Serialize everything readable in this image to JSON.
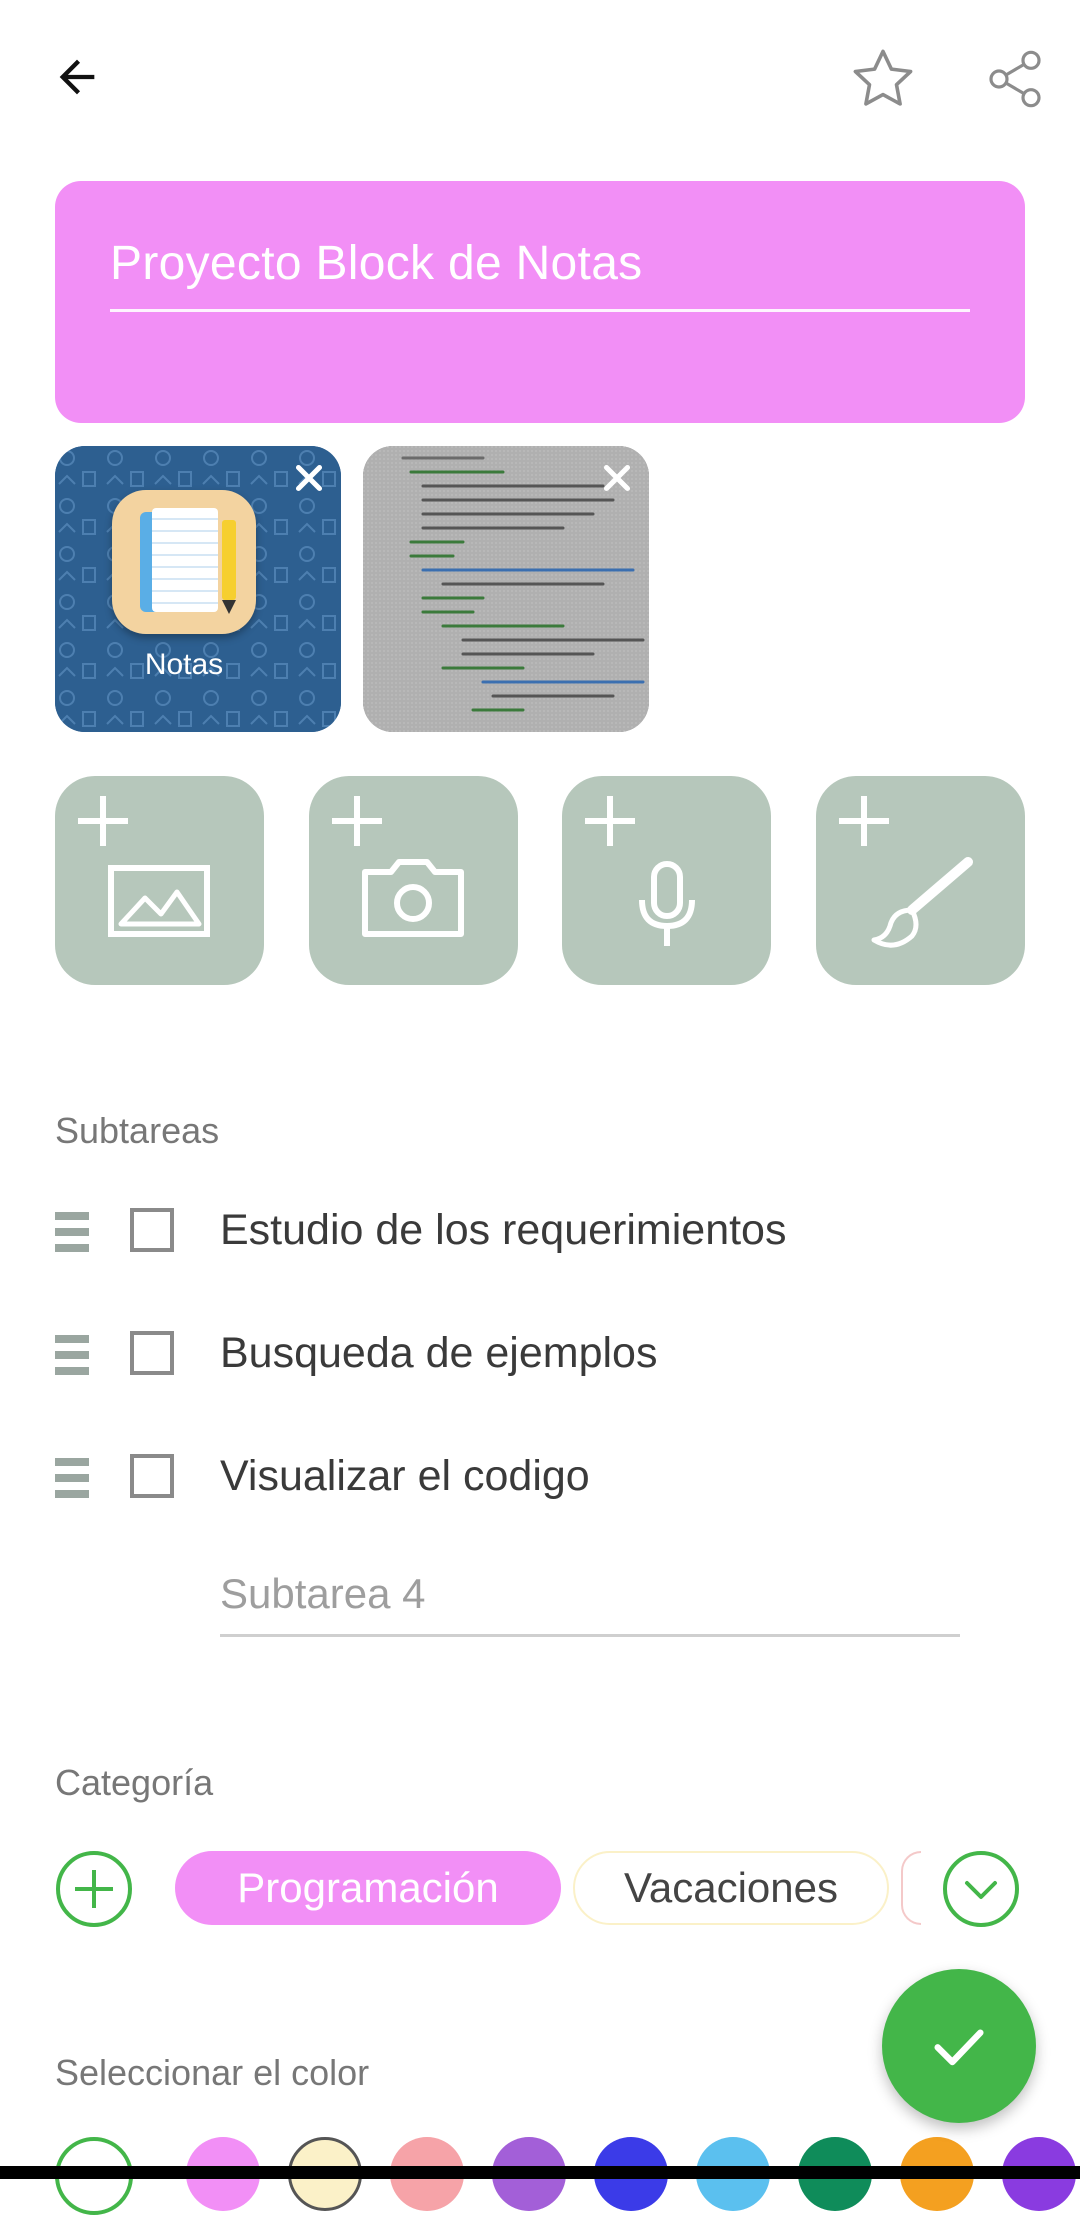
{
  "title": {
    "value": "Proyecto Block de Notas"
  },
  "thumbnails": [
    {
      "name": "Notas",
      "kind": "app-icon"
    },
    {
      "name": "",
      "kind": "code-photo"
    }
  ],
  "subtasks": {
    "label": "Subtareas",
    "items": [
      {
        "text": "Estudio de los requerimientos",
        "checked": false
      },
      {
        "text": "Busqueda de ejemplos",
        "checked": false
      },
      {
        "text": "Visualizar el codigo",
        "checked": false
      }
    ],
    "new_placeholder": "Subtarea 4"
  },
  "category": {
    "label": "Categoría",
    "chips": [
      {
        "label": "Programación",
        "selected": true,
        "color": "#f28ff6"
      },
      {
        "label": "Vacaciones",
        "selected": false,
        "color": "#fbf1c8"
      }
    ]
  },
  "color_section": {
    "label": "Seleccionar el color",
    "swatches": [
      "#f28ff6",
      "#fbf1c8",
      "#f6a3a8",
      "#a35fd8",
      "#3b3be8",
      "#5bc0ef",
      "#0f8c5a",
      "#f4a020",
      "#8a3be0"
    ]
  },
  "colors": {
    "accent_green": "#43b649",
    "button_gray": "#b6c7bb",
    "title_card": "#f28ff6"
  },
  "icons": {
    "back": "back-arrow-icon",
    "favorite": "star-icon",
    "share": "share-icon",
    "add_image": "add-image-icon",
    "add_camera": "add-camera-icon",
    "add_audio": "add-microphone-icon",
    "add_draw": "add-brush-icon",
    "confirm": "check-icon"
  }
}
